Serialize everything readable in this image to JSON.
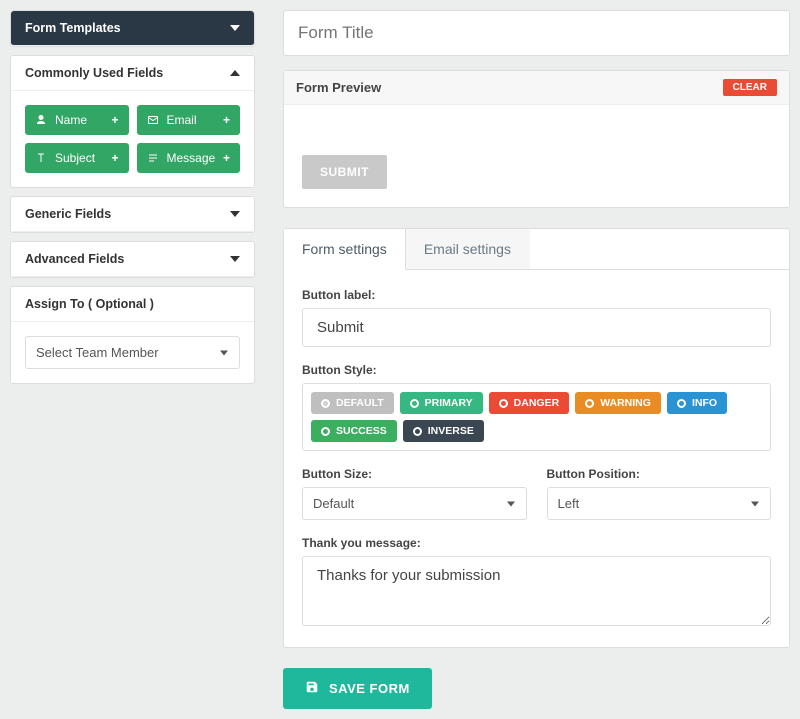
{
  "sidebar": {
    "templates_header": "Form Templates",
    "common_header": "Commonly Used Fields",
    "common_fields": [
      {
        "icon": "person-icon",
        "label": "Name"
      },
      {
        "icon": "envelope-icon",
        "label": "Email"
      },
      {
        "icon": "text-icon",
        "label": "Subject"
      },
      {
        "icon": "lines-icon",
        "label": "Message"
      }
    ],
    "generic_header": "Generic Fields",
    "advanced_header": "Advanced Fields",
    "assign_header": "Assign To ( Optional )",
    "assign_placeholder": "Select Team Member"
  },
  "main": {
    "title_placeholder": "Form Title",
    "preview_header": "Form Preview",
    "clear_label": "CLEAR",
    "preview_submit": "SUBMIT",
    "tabs": [
      {
        "label": "Form settings",
        "active": true
      },
      {
        "label": "Email settings",
        "active": false
      }
    ],
    "button_label_label": "Button label:",
    "button_label_value": "Submit",
    "button_style_label": "Button Style:",
    "styles": [
      {
        "label": "DEFAULT",
        "cls": "s-default",
        "selected": true
      },
      {
        "label": "PRIMARY",
        "cls": "s-primary",
        "selected": false
      },
      {
        "label": "DANGER",
        "cls": "s-danger",
        "selected": false
      },
      {
        "label": "WARNING",
        "cls": "s-warning",
        "selected": false
      },
      {
        "label": "INFO",
        "cls": "s-info",
        "selected": false
      },
      {
        "label": "SUCCESS",
        "cls": "s-success",
        "selected": false
      },
      {
        "label": "INVERSE",
        "cls": "s-inverse",
        "selected": false
      }
    ],
    "button_size_label": "Button Size:",
    "button_size_value": "Default",
    "button_position_label": "Button Position:",
    "button_position_value": "Left",
    "thanks_label": "Thank you message:",
    "thanks_value": "Thanks for your submission",
    "save_label": "SAVE FORM"
  }
}
